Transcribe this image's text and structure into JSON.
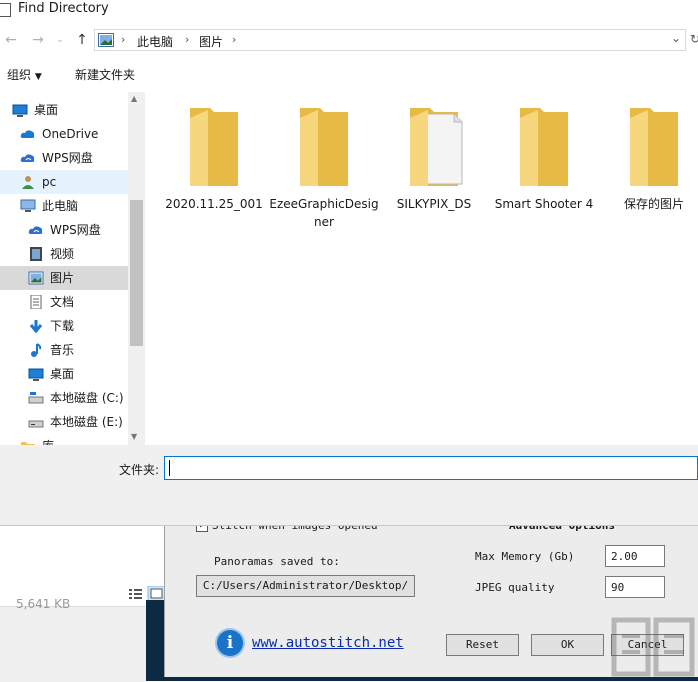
{
  "window": {
    "title": "Find Directory"
  },
  "address": {
    "crumbs": [
      "此电脑",
      "图片"
    ]
  },
  "toolbar": {
    "organize": "组织",
    "new_folder": "新建文件夹"
  },
  "nav_items": [
    {
      "label": "桌面",
      "icon": "desktop-icon",
      "state": "normal"
    },
    {
      "label": "OneDrive",
      "icon": "cloud-icon",
      "state": "normal"
    },
    {
      "label": "WPS网盘",
      "icon": "wps-cloud-icon",
      "state": "normal"
    },
    {
      "label": "pc",
      "icon": "user-icon",
      "state": "hover"
    },
    {
      "label": "此电脑",
      "icon": "computer-icon",
      "state": "normal"
    },
    {
      "label": "WPS网盘",
      "icon": "wps-cloud-icon",
      "state": "normal"
    },
    {
      "label": "视频",
      "icon": "video-icon",
      "state": "normal"
    },
    {
      "label": "图片",
      "icon": "pictures-icon",
      "state": "selected"
    },
    {
      "label": "文档",
      "icon": "documents-icon",
      "state": "normal"
    },
    {
      "label": "下载",
      "icon": "download-icon",
      "state": "normal"
    },
    {
      "label": "音乐",
      "icon": "music-icon",
      "state": "normal"
    },
    {
      "label": "桌面",
      "icon": "desktop-icon",
      "state": "normal"
    },
    {
      "label": "本地磁盘 (C:)",
      "icon": "drive-c-icon",
      "state": "normal"
    },
    {
      "label": "本地磁盘 (E:)",
      "icon": "drive-icon",
      "state": "normal"
    },
    {
      "label": "库",
      "icon": "library-icon",
      "state": "normal"
    }
  ],
  "folders": [
    {
      "name": "2020.11.25_001"
    },
    {
      "name": "EzeeGraphicDesigner"
    },
    {
      "name": "SILKYPIX_DS"
    },
    {
      "name": "Smart Shooter 4"
    },
    {
      "name": "保存的图片"
    }
  ],
  "filename": {
    "label": "文件夹:",
    "value": ""
  },
  "background": {
    "size_text": "5,641 KB"
  },
  "options": {
    "stitch_label": "Stitch when images opened",
    "advanced_label": "Advanced Options",
    "panoramas_label": "Panoramas saved to:",
    "path_value": "C:/Users/Administrator/Desktop/",
    "max_memory_label": "Max Memory (Gb)",
    "max_memory_value": "2.00",
    "jpeg_label": "JPEG quality",
    "jpeg_value": "90",
    "link_text": "www.autostitch.net",
    "reset_label": "Reset",
    "ok_label": "OK",
    "cancel_label": "Cancel"
  },
  "colors": {
    "folder": "#f5cf6b",
    "accent": "#0078d7",
    "selected": "#d9d9d9",
    "hover": "#e5f3ff"
  }
}
